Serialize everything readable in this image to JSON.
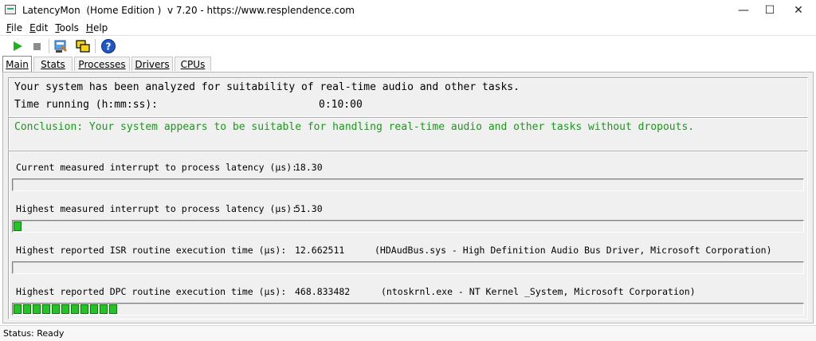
{
  "window": {
    "title": "LatencyMon  (Home Edition )  v 7.20 - https://www.resplendence.com",
    "minimize": "—",
    "maximize": "☐",
    "close": "✕"
  },
  "menu": [
    {
      "label": "File",
      "key": "F",
      "rest": "ile"
    },
    {
      "label": "Edit",
      "key": "E",
      "rest": "dit"
    },
    {
      "label": "Tools",
      "key": "T",
      "rest": "ools"
    },
    {
      "label": "Help",
      "key": "H",
      "rest": "elp"
    }
  ],
  "toolbar": {
    "icons": [
      "play-icon",
      "stop-icon",
      "process-icon",
      "windows-icon",
      "help-icon"
    ],
    "colors": {
      "play": "#1fb41f",
      "stop": "#8c8c8c",
      "help": "#1f56c8"
    }
  },
  "tabs": [
    {
      "label": "Main",
      "active": true
    },
    {
      "label": "Stats",
      "active": false
    },
    {
      "label": "Processes",
      "active": false
    },
    {
      "label": "Drivers",
      "active": false
    },
    {
      "label": "CPUs",
      "active": false
    }
  ],
  "main": {
    "summary": "Your system has been analyzed for suitability of real-time audio and other tasks.",
    "time_running_label": "Time running (h:mm:ss):",
    "time_running_value": "0:10:00",
    "conclusion": "Conclusion: Your system appears to be suitable for handling real-time audio and other tasks without dropouts.",
    "conclusion_color": "#1a9a1a",
    "metrics": [
      {
        "label": "Current measured interrupt to process latency (µs):",
        "value": "18.30",
        "detail": "",
        "bar_segments": 0
      },
      {
        "label": "Highest measured interrupt to process latency (µs):",
        "value": "51.30",
        "detail": "",
        "bar_segments": 1
      },
      {
        "label": "Highest reported ISR routine execution time (µs):",
        "value": "12.662511",
        "detail": "(HDAudBus.sys - High Definition Audio Bus Driver, Microsoft Corporation)",
        "bar_segments": 0
      },
      {
        "label": "Highest reported DPC routine execution time (µs):",
        "value": "468.833482",
        "detail": "(ntoskrnl.exe - NT Kernel _System, Microsoft Corporation)",
        "bar_segments": 11
      }
    ],
    "bar_color": "#23c423"
  },
  "status": {
    "text": "Status: Ready"
  }
}
